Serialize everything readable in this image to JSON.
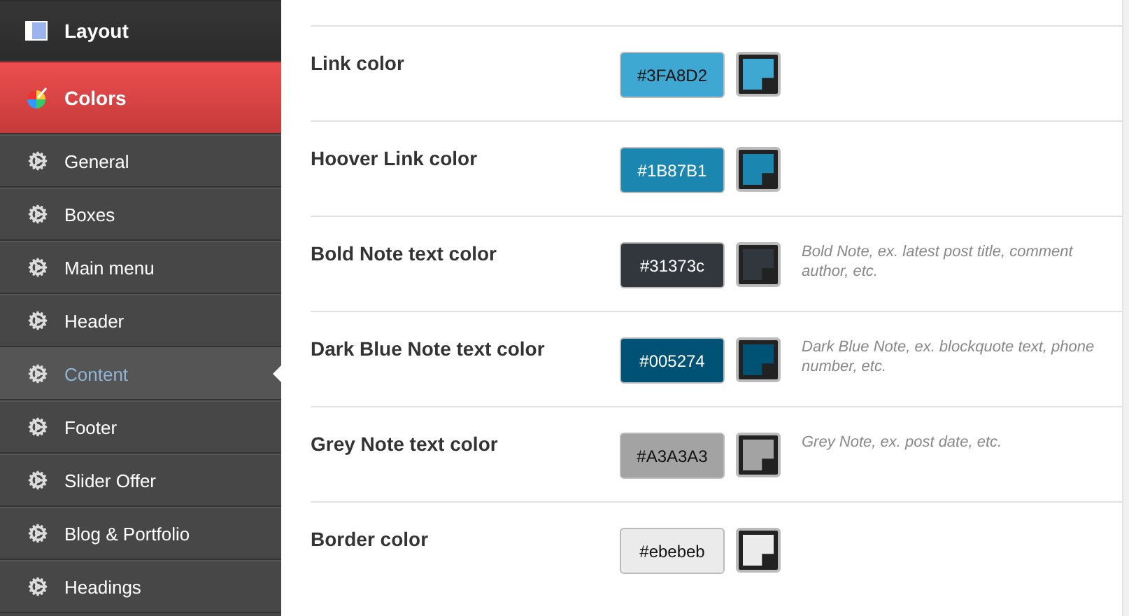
{
  "sidebar": {
    "items": [
      {
        "label": "Layout",
        "kind": "section",
        "selected": false
      },
      {
        "label": "Colors",
        "kind": "section",
        "selected": true
      },
      {
        "label": "General",
        "kind": "sub",
        "selected": false
      },
      {
        "label": "Boxes",
        "kind": "sub",
        "selected": false
      },
      {
        "label": "Main menu",
        "kind": "sub",
        "selected": false
      },
      {
        "label": "Header",
        "kind": "sub",
        "selected": false
      },
      {
        "label": "Content",
        "kind": "sub",
        "selected": true
      },
      {
        "label": "Footer",
        "kind": "sub",
        "selected": false
      },
      {
        "label": "Slider Offer",
        "kind": "sub",
        "selected": false
      },
      {
        "label": "Blog & Portfolio",
        "kind": "sub",
        "selected": false
      },
      {
        "label": "Headings",
        "kind": "sub",
        "selected": false
      }
    ]
  },
  "settings": [
    {
      "label": "Link color",
      "value": "#3FA8D2",
      "color": "#3fa8d2"
    },
    {
      "label": "Hoover Link color",
      "value": "#1B87B1",
      "color": "#1b87b1"
    },
    {
      "label": "Bold Note text color",
      "value": "#31373c",
      "color": "#31373c",
      "note": "Bold Note, ex. latest post title, comment author, etc."
    },
    {
      "label": "Dark Blue Note text color",
      "value": "#005274",
      "color": "#005274",
      "note": "Dark Blue Note, ex. blockquote text, phone number, etc."
    },
    {
      "label": "Grey Note text color",
      "value": "#A3A3A3",
      "color": "#a3a3a3",
      "note": "Grey Note, ex. post date, etc."
    },
    {
      "label": "Border color",
      "value": "#ebebeb",
      "color": "#ebebeb"
    }
  ]
}
